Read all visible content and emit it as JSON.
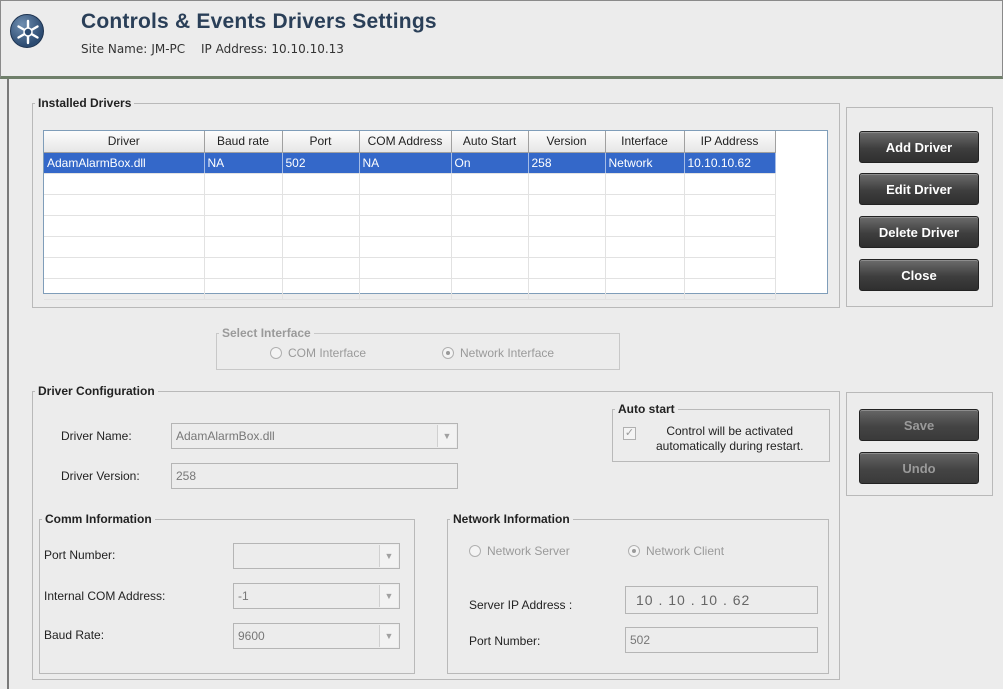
{
  "header": {
    "title": "Controls & Events Drivers Settings",
    "site_name_label": "Site Name:",
    "site_name": "JM-PC",
    "ip_label": "IP Address:",
    "ip": "10.10.10.13"
  },
  "installed_drivers": {
    "legend": "Installed Drivers",
    "columns": [
      "Driver",
      "Baud rate",
      "Port",
      "COM Address",
      "Auto Start",
      "Version",
      "Interface",
      "IP Address"
    ],
    "rows": [
      [
        "AdamAlarmBox.dll",
        "NA",
        "502",
        "NA",
        "On",
        "258",
        "Network",
        "10.10.10.62"
      ]
    ],
    "selected_row": 0
  },
  "side_buttons": {
    "add": "Add Driver",
    "edit": "Edit Driver",
    "delete": "Delete Driver",
    "close": "Close"
  },
  "select_interface": {
    "legend": "Select Interface",
    "com": "COM Interface",
    "network": "Network Interface",
    "selected": "network"
  },
  "driver_config": {
    "legend": "Driver Configuration",
    "name_label": "Driver Name:",
    "name_value": "AdamAlarmBox.dll",
    "version_label": "Driver Version:",
    "version_value": "258"
  },
  "auto_start": {
    "legend": "Auto start",
    "text_line1": "Control will be activated",
    "text_line2": "automatically during restart.",
    "checked": true
  },
  "save_buttons": {
    "save": "Save",
    "undo": "Undo"
  },
  "comm_info": {
    "legend": "Comm Information",
    "port_label": "Port Number:",
    "port_value": "",
    "com_address_label": "Internal COM Address:",
    "com_address_value": "-1",
    "baud_label": "Baud Rate:",
    "baud_value": "9600"
  },
  "network_info": {
    "legend": "Network Information",
    "server": "Network Server",
    "client": "Network Client",
    "selected": "client",
    "server_ip_label": "Server IP Address :",
    "ip_octets": [
      "10",
      "10",
      "10",
      "62"
    ],
    "port_label": "Port Number:",
    "port_value": "502"
  },
  "colors": {
    "selection": "#3468c9",
    "title": "#2a3f58",
    "button_dark": "#3e3e3e"
  }
}
